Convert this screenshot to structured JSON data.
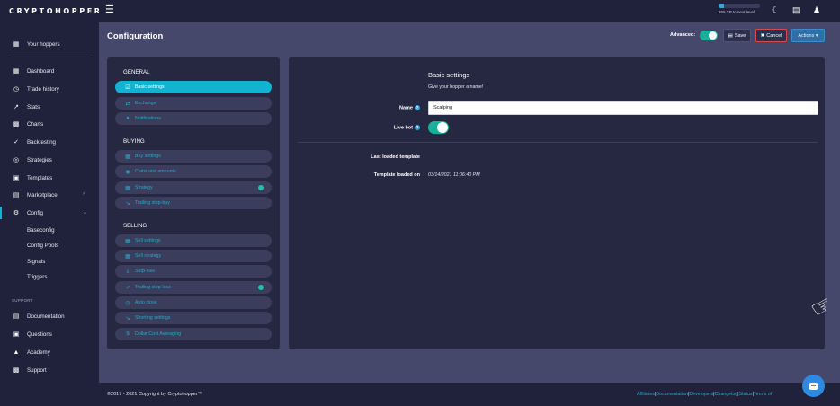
{
  "topbar": {
    "logo": "CRYPTOHOPPER",
    "xp_progress": 0.12,
    "xp_text": "365 XP to next level!",
    "icons": [
      "menu-icon",
      "moon-icon",
      "chat-icon",
      "user-icon"
    ]
  },
  "sidebar": {
    "hoppers_label": "Your hoppers",
    "items": [
      {
        "label": "Dashboard",
        "icon": "dashboard-icon"
      },
      {
        "label": "Trade history",
        "icon": "history-icon"
      },
      {
        "label": "Stats",
        "icon": "stats-icon"
      },
      {
        "label": "Charts",
        "icon": "charts-icon"
      },
      {
        "label": "Backtesting",
        "icon": "backtesting-icon"
      },
      {
        "label": "Strategies",
        "icon": "strategies-icon"
      },
      {
        "label": "Templates",
        "icon": "templates-icon"
      },
      {
        "label": "Marketplace",
        "icon": "marketplace-icon"
      },
      {
        "label": "Config",
        "icon": "config-icon"
      }
    ],
    "config_sub": [
      "Baseconfig",
      "Config Pools",
      "Signals",
      "Triggers"
    ],
    "support_heading": "SUPPORT",
    "support_items": [
      {
        "label": "Documentation",
        "icon": "documentation-icon"
      },
      {
        "label": "Questions",
        "icon": "questions-icon"
      },
      {
        "label": "Academy",
        "icon": "academy-icon"
      },
      {
        "label": "Support",
        "icon": "support-icon"
      }
    ]
  },
  "header": {
    "title": "Configuration",
    "advanced_label": "Advanced:",
    "advanced_on": true,
    "save_label": "Save",
    "cancel_label": "Cancel",
    "actions_label": "Actions ▾"
  },
  "config_menu": {
    "general_heading": "GENERAL",
    "general": [
      "Basic settings",
      "Exchange",
      "Notifications"
    ],
    "buying_heading": "BUYING",
    "buying": [
      "Buy settings",
      "Coins and amounts",
      "Strategy",
      "Trailing stop-buy"
    ],
    "selling_heading": "SELLING",
    "selling": [
      "Sell settings",
      "Sell strategy",
      "Stop-loss",
      "Trailing stop-loss",
      "Auto close",
      "Shorting settings",
      "Dollar Cost Averaging"
    ],
    "active_item": "Basic settings"
  },
  "settings": {
    "title": "Basic settings",
    "subtitle": "Give your hopper a name!",
    "name_label": "Name",
    "name_value": "Scalping",
    "live_bot_label": "Live bot",
    "live_bot_on": true,
    "last_loaded_label": "Last loaded template",
    "last_loaded_value": "",
    "template_loaded_on_label": "Template loaded on",
    "template_loaded_on_value": "03/14/2021 11:06:40 PM"
  },
  "footer": {
    "copyright": "©2017 - 2021 Copyright by Cryptohopper™",
    "links": [
      "Affiliates",
      "Documentation",
      "Developers",
      "Changelog",
      "Status",
      "Terms of"
    ]
  },
  "colors": {
    "accent": "#12b2d2",
    "toggle_on": "#17b09a",
    "sidebar_bg": "#20213a",
    "content_bg": "#46486b",
    "panel_bg": "#262842",
    "cancel_border": "#d84a4a",
    "actions_bg": "#2e6fa7"
  }
}
